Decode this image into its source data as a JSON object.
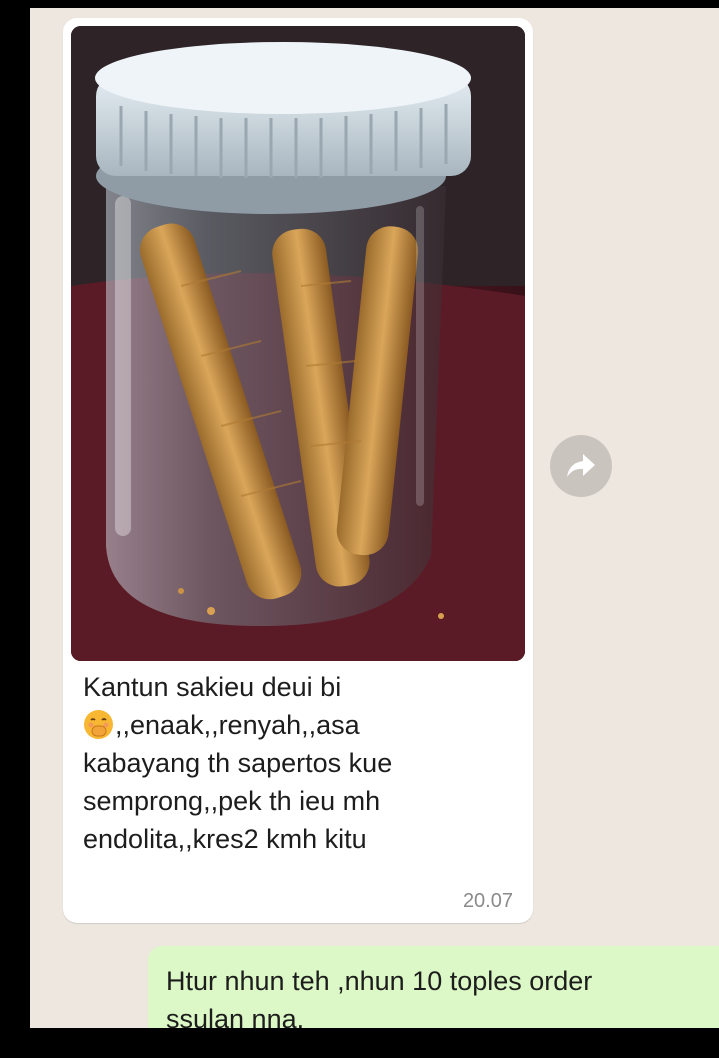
{
  "chat": {
    "incoming": {
      "image_alt": "jar of wafer roll cookies",
      "caption_line1": "Kantun sakieu deui bi",
      "caption_emoji": "hand-over-mouth-emoji",
      "caption_line2": ",,enaak,,renyah,,asa",
      "caption_line3": "kabayang th sapertos kue",
      "caption_line4": "semprong,,pek th ieu mh",
      "caption_line5": "endolita,,kres2 kmh kitu",
      "time": "20.07"
    },
    "forward_icon": "forward-arrow-icon",
    "outgoing": {
      "line1": "Htur nhun teh ,nhun 10 toples order",
      "line2": "ssulan nna."
    }
  },
  "colors": {
    "background": "#ede7e0",
    "incoming_bubble": "#ffffff",
    "outgoing_bubble": "#dcf8c6",
    "forward_button": "#c9c4be"
  }
}
